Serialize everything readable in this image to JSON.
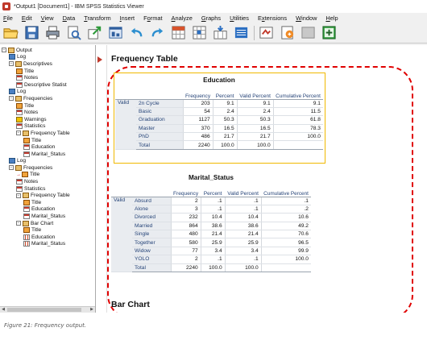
{
  "window": {
    "title": "*Output1 [Document1] - IBM SPSS Statistics Viewer"
  },
  "menubar": {
    "items": [
      {
        "mnemonic": "F",
        "rest": "ile"
      },
      {
        "mnemonic": "E",
        "rest": "dit"
      },
      {
        "mnemonic": "V",
        "rest": "iew"
      },
      {
        "mnemonic": "D",
        "rest": "ata"
      },
      {
        "mnemonic": "T",
        "rest": "ransform"
      },
      {
        "mnemonic": "I",
        "rest": "nsert"
      },
      {
        "mnemonic": "",
        "pre": "F",
        "mid": "o",
        "rest": "rmat"
      },
      {
        "mnemonic": "A",
        "rest": "nalyze"
      },
      {
        "mnemonic": "G",
        "rest": "raphs"
      },
      {
        "mnemonic": "U",
        "rest": "tilities"
      },
      {
        "mnemonic": "",
        "pre": "E",
        "mid": "x",
        "rest": "tensions"
      },
      {
        "mnemonic": "W",
        "rest": "indow"
      },
      {
        "mnemonic": "H",
        "rest": "elp"
      }
    ]
  },
  "toolbar": {
    "icons": [
      "open-folder-icon",
      "save-icon",
      "print-icon",
      "print-preview-icon",
      "export-icon",
      "recall-dialog-icon",
      "undo-icon",
      "redo-icon",
      "goto-data-icon",
      "goto-case-icon",
      "goto-variable-icon",
      "variables-icon",
      "designate-window-icon",
      "create-title-icon",
      "insert-output-icon",
      "add-item-icon"
    ]
  },
  "outline": {
    "nodes": [
      {
        "label": "Output",
        "level": 0,
        "icon": "book",
        "expander": "−"
      },
      {
        "label": "Log",
        "level": 1,
        "icon": "log"
      },
      {
        "label": "Descriptives",
        "level": 1,
        "icon": "book",
        "expander": "−"
      },
      {
        "label": "Title",
        "level": 2,
        "icon": "hier"
      },
      {
        "label": "Notes",
        "level": 2,
        "icon": "tbl"
      },
      {
        "label": "Descriptive Statist",
        "level": 2,
        "icon": "tbl"
      },
      {
        "label": "Log",
        "level": 1,
        "icon": "log"
      },
      {
        "label": "Frequencies",
        "level": 1,
        "icon": "book",
        "expander": "−"
      },
      {
        "label": "Title",
        "level": 2,
        "icon": "hier"
      },
      {
        "label": "Notes",
        "level": 2,
        "icon": "tbl"
      },
      {
        "label": "Warnings",
        "level": 2,
        "icon": "warn"
      },
      {
        "label": "Statistics",
        "level": 2,
        "icon": "tbl"
      },
      {
        "label": "Frequency Table",
        "level": 2,
        "icon": "book",
        "expander": "−"
      },
      {
        "label": "Title",
        "level": 3,
        "icon": "hier"
      },
      {
        "label": "Education",
        "level": 3,
        "icon": "tbl"
      },
      {
        "label": "Marital_Status",
        "level": 3,
        "icon": "tbl"
      },
      {
        "label": "Log",
        "level": 1,
        "icon": "log"
      },
      {
        "label": "Frequencies",
        "level": 1,
        "icon": "book",
        "expander": "−"
      },
      {
        "label": "Title",
        "level": 2,
        "icon": "hier",
        "arrow": "→"
      },
      {
        "label": "Notes",
        "level": 2,
        "icon": "tbl"
      },
      {
        "label": "Statistics",
        "level": 2,
        "icon": "tbl"
      },
      {
        "label": "Frequency Table",
        "level": 2,
        "icon": "book",
        "expander": "−"
      },
      {
        "label": "Title",
        "level": 3,
        "icon": "hier"
      },
      {
        "label": "Education",
        "level": 3,
        "icon": "tbl"
      },
      {
        "label": "Marital_Status",
        "level": 3,
        "icon": "tbl"
      },
      {
        "label": "Bar Chart",
        "level": 2,
        "icon": "book",
        "expander": "−"
      },
      {
        "label": "Title",
        "level": 3,
        "icon": "hier"
      },
      {
        "label": "Education",
        "level": 3,
        "icon": "chart"
      },
      {
        "label": "Marital_Status",
        "level": 3,
        "icon": "chart"
      }
    ]
  },
  "viewer": {
    "section_frequency_table": "Frequency Table",
    "section_bar_chart": "Bar Chart",
    "education": {
      "caption": "Education",
      "columns": [
        "Frequency",
        "Percent",
        "Valid Percent",
        "Cumulative Percent"
      ],
      "group_label": "Valid",
      "rows": [
        {
          "label": "2n Cycle",
          "cells": [
            "203",
            "9.1",
            "9.1",
            "9.1"
          ]
        },
        {
          "label": "Basic",
          "cells": [
            "54",
            "2.4",
            "2.4",
            "11.5"
          ]
        },
        {
          "label": "Graduation",
          "cells": [
            "1127",
            "50.3",
            "50.3",
            "61.8"
          ]
        },
        {
          "label": "Master",
          "cells": [
            "370",
            "16.5",
            "16.5",
            "78.3"
          ]
        },
        {
          "label": "PhD",
          "cells": [
            "486",
            "21.7",
            "21.7",
            "100.0"
          ]
        },
        {
          "label": "Total",
          "cells": [
            "2240",
            "100.0",
            "100.0",
            ""
          ]
        }
      ]
    },
    "marital": {
      "caption": "Marital_Status",
      "columns": [
        "Frequency",
        "Percent",
        "Valid Percent",
        "Cumulative Percent"
      ],
      "group_label": "Valid",
      "rows": [
        {
          "label": "Absurd",
          "cells": [
            "2",
            ".1",
            ".1",
            ".1"
          ]
        },
        {
          "label": "Alone",
          "cells": [
            "3",
            ".1",
            ".1",
            ".2"
          ]
        },
        {
          "label": "Divorced",
          "cells": [
            "232",
            "10.4",
            "10.4",
            "10.6"
          ]
        },
        {
          "label": "Married",
          "cells": [
            "864",
            "38.6",
            "38.6",
            "49.2"
          ]
        },
        {
          "label": "Single",
          "cells": [
            "480",
            "21.4",
            "21.4",
            "70.6"
          ]
        },
        {
          "label": "Together",
          "cells": [
            "580",
            "25.9",
            "25.9",
            "96.5"
          ]
        },
        {
          "label": "Widow",
          "cells": [
            "77",
            "3.4",
            "3.4",
            "99.9"
          ]
        },
        {
          "label": "YOLO",
          "cells": [
            "2",
            ".1",
            ".1",
            "100.0"
          ]
        },
        {
          "label": "Total",
          "cells": [
            "2240",
            "100.0",
            "100.0",
            ""
          ]
        }
      ]
    }
  },
  "colors": {
    "highlight_dashed": "#e00000",
    "selected_table_border": "#f0b800",
    "header_text": "#264478"
  },
  "caption": "Figure 21: Frequency output."
}
